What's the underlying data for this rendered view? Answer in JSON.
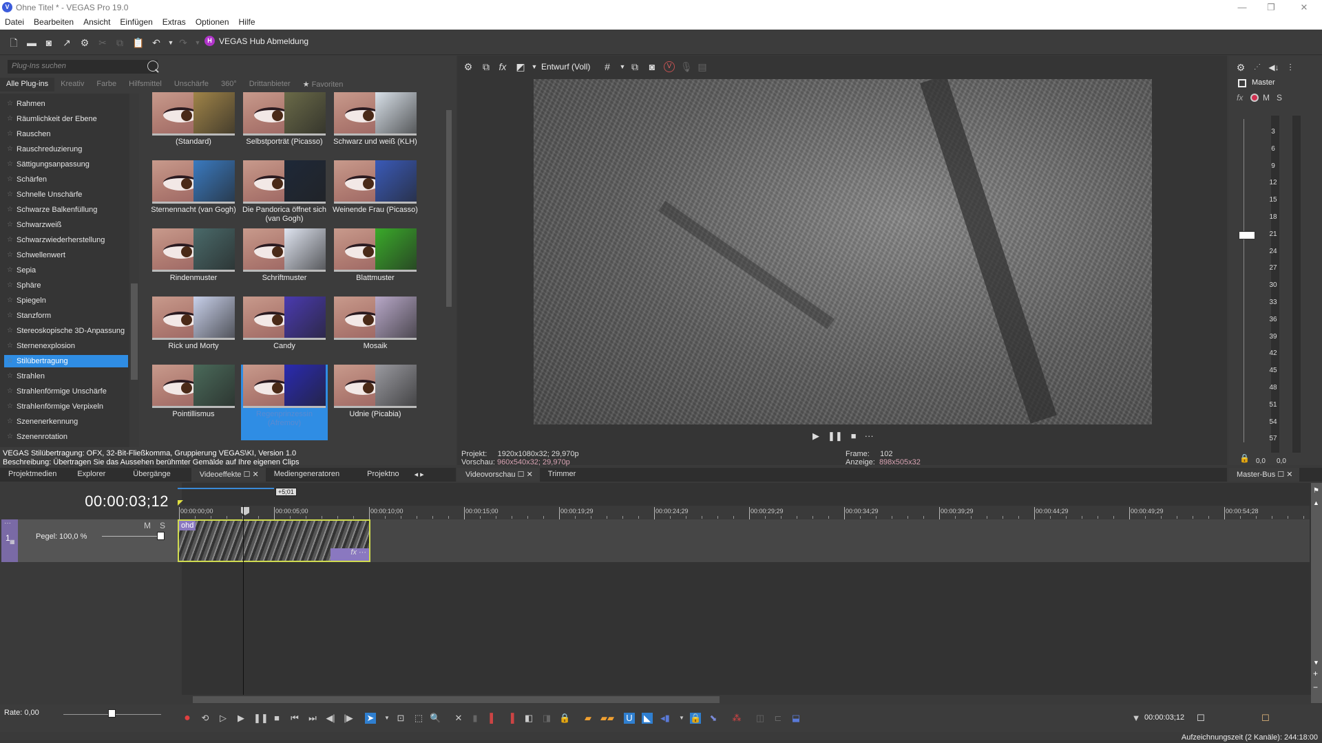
{
  "window": {
    "title": "Ohne Titel * - VEGAS Pro 19.0",
    "logo_letter": "V",
    "controls": {
      "minimize": "—",
      "restore": "❐",
      "close": "✕"
    }
  },
  "menu": [
    "Datei",
    "Bearbeiten",
    "Ansicht",
    "Einfügen",
    "Extras",
    "Optionen",
    "Hilfe"
  ],
  "toolbar": {
    "hub_letter": "H",
    "hub_label": "VEGAS Hub Abmeldung"
  },
  "plugins": {
    "search_placeholder": "Plug-Ins suchen",
    "categories": [
      "Alle Plug-ins",
      "Kreativ",
      "Farbe",
      "Hilfsmittel",
      "Unschärfe",
      "360°",
      "Drittanbieter",
      "Favoriten"
    ],
    "active_category": "Alle Plug-ins",
    "list": [
      "Rahmen",
      "Räumlichkeit der Ebene",
      "Rauschen",
      "Rauschreduzierung",
      "Sättigungsanpassung",
      "Schärfen",
      "Schnelle Unschärfe",
      "Schwarze Balkenfüllung",
      "Schwarzweiß",
      "Schwarzwiederherstellung",
      "Schwellenwert",
      "Sepia",
      "Sphäre",
      "Spiegeln",
      "Stanzform",
      "Stereoskopische 3D-Anpassung",
      "Sternenexplosion",
      "Stilübertragung",
      "Strahlen",
      "Strahlenförmige Unschärfe",
      "Strahlenförmige Verpixeln",
      "Szenenerkennung",
      "Szenenrotation"
    ],
    "selected_plugin": "Stilübertragung",
    "presets": [
      {
        "label": "(Standard)",
        "art": "#a08448"
      },
      {
        "label": "Selbstporträt (Picasso)",
        "art": "#6a6a48"
      },
      {
        "label": "Schwarz und weiß (KLH)",
        "art": "#d8e0e8"
      },
      {
        "label": "Sternennacht (van Gogh)",
        "art": "#3a7ac0"
      },
      {
        "label": "Die Pandorica öffnet sich (van Gogh)",
        "art": "#1e2838"
      },
      {
        "label": "Weinende Frau (Picasso)",
        "art": "#3a5ab8"
      },
      {
        "label": "Rindenmuster",
        "art": "#4a6a6a"
      },
      {
        "label": "Schriftmuster",
        "art": "#dfe4f0"
      },
      {
        "label": "Blattmuster",
        "art": "#3aaa2a"
      },
      {
        "label": "Rick und Morty",
        "art": "#c8d0ea"
      },
      {
        "label": "Candy",
        "art": "#4a3ab0"
      },
      {
        "label": "Mosaik",
        "art": "#b8a8c8"
      },
      {
        "label": "Pointillismus",
        "art": "#4a6a5a"
      },
      {
        "label": "Regenprinzessin (Afremov)",
        "art": "#2a2ab0"
      },
      {
        "label": "Udnie (Picabia)",
        "art": "#9a9aa0"
      }
    ],
    "selected_preset": "Regenprinzessin (Afremov)",
    "description_line1": "VEGAS Stilübertragung: OFX, 32-Bit-Fließkomma, Gruppierung VEGAS\\KI, Version 1.0",
    "description_line2": "Beschreibung: Übertragen Sie das Aussehen berühmter Gemälde auf Ihre eigenen Clips"
  },
  "dock_tabs": [
    "Projektmedien",
    "Explorer",
    "Übergänge",
    "Videoeffekte",
    "Mediengeneratoren",
    "Projektno"
  ],
  "active_dock_tab": "Videoeffekte",
  "preview": {
    "quality": "Entwurf (Voll)",
    "project_label": "Projekt:",
    "project_value": "1920x1080x32; 29,970p",
    "preview_label": "Vorschau:",
    "preview_value": "960x540x32; 29,970p",
    "frame_label": "Frame:",
    "frame_value": "102",
    "display_label": "Anzeige:",
    "display_value": "898x505x32",
    "tabs": [
      "Videovorschau",
      "Trimmer"
    ],
    "more": "···"
  },
  "master": {
    "label": "Master",
    "fx": "fx",
    "mute": "M",
    "solo": "S",
    "scale": [
      "3",
      "6",
      "9",
      "12",
      "15",
      "18",
      "21",
      "24",
      "27",
      "30",
      "33",
      "36",
      "39",
      "42",
      "45",
      "48",
      "51",
      "54",
      "57"
    ],
    "left_value": "0,0",
    "right_value": "0,0",
    "tab_label": "Master-Bus"
  },
  "timeline": {
    "timecode": "00:00:03;12",
    "loop_length": "+5;01",
    "ruler": [
      "00:00:00;00",
      "00:00:05;00",
      "00:00:10;00",
      "00:00:15;00",
      "00:00:19;29",
      "00:00:24;29",
      "00:00:29;29",
      "00:00:34;29",
      "00:00:39;29",
      "00:00:44;29",
      "00:00:49;29",
      "00:00:54;28"
    ],
    "track": {
      "number": "1",
      "mute": "M",
      "solo": "S",
      "level_label": "Pegel:",
      "level_value": "100,0 %",
      "clip_label": "ohd",
      "clip_fx": "fx"
    }
  },
  "bottom": {
    "rate_label": "Rate: 0,00",
    "cursor_time": "00:00:03;12",
    "status": "Aufzeichnungszeit (2 Kanäle): 244:18:00"
  }
}
